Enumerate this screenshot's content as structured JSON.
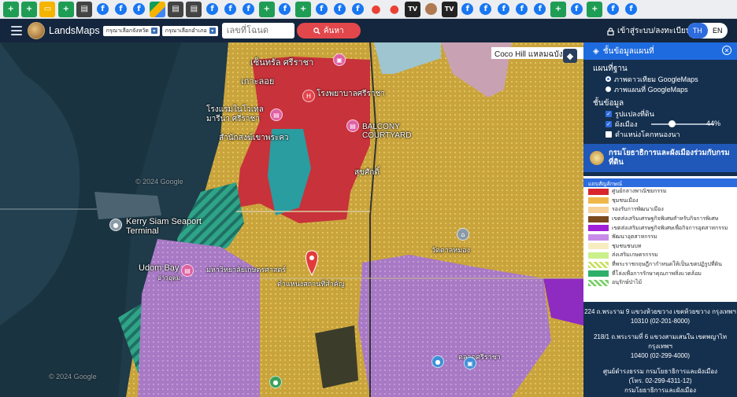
{
  "header": {
    "brand": "LandsMaps",
    "province_placeholder": "กรุณาเลือกจังหวัด",
    "district_placeholder": "กรุณาเลือกอำเภอ",
    "deed_placeholder": "เลขที่โฉนด",
    "search_label": "ค้นหา",
    "login_label": "เข้าสู่ระบบ/ลงทะเบียน",
    "lang_th": "TH",
    "lang_en": "EN"
  },
  "bookmarks": [
    "sheet",
    "sheet",
    "slide",
    "sheet",
    "doc",
    "fb",
    "fb",
    "fb",
    "drive",
    "doc",
    "doc",
    "fb",
    "fb",
    "fb",
    "sheet",
    "fb",
    "sheet",
    "fb",
    "fb",
    "fb",
    "pin",
    "pin",
    "tv",
    "photo",
    "tv",
    "fb",
    "fb",
    "fb",
    "fb",
    "fb",
    "sheet",
    "fb",
    "sheet",
    "fb",
    "fb"
  ],
  "map": {
    "tooltip": "Coco Hill แหลมฉบัง",
    "labels": {
      "central": "เซ็นทรัล ศรีราชา",
      "koh_loi": "เกาะลอย",
      "hospital": "โรงพยาบาลศรีราชา",
      "hotel": "โรงแรมในโวเทล มารีนา ศรีราชา",
      "office": "สำนักสงฆ์เขาพระคว",
      "balcony": "BALCONY COURTYARD",
      "kerry": "Kerry Siam Seaport Terminal",
      "udom_bay": "Udom Bay",
      "udom_bay_th": "อ่าวอุดม",
      "university": "มหาวิทยาลัยเกษตรศาสตร์",
      "landmark": "ตำแหน่งสถานที่สำคัญ",
      "sukhumvit": "สุขศักดิ์",
      "wat": "วัดตาลหมอง",
      "market": "ตลาดศรีราชา",
      "copyright1": "© 2024 Google",
      "copyright2": "© 2024 Google"
    }
  },
  "panel": {
    "title": "ชั้นข้อมูลแผนที่",
    "basemap_title": "แผนที่ฐาน",
    "basemap_options": [
      "ภาพดาวเทียม GoogleMaps",
      "ภาพแผนที่ GoogleMaps"
    ],
    "layers_title": "ชั้นข้อมูล",
    "layer_options": [
      "รูปแปลงที่ดิน",
      "ผังเมือง",
      "ตำแหน่งโคกหนองนา"
    ],
    "opacity": "44%",
    "org_name": "กรมโยธาธิการและผังเมืองร่วมกับกรมที่ดิน",
    "legend_title": "แถบสัญลักษณ์",
    "legend": [
      {
        "label": "ศูนย์กลางพาณิชยกรรม",
        "color": "#d9262c"
      },
      {
        "label": "ชุมชนเมือง",
        "color": "#f0b84a"
      },
      {
        "label": "รองรับการพัฒนาเมือง",
        "color": "#f7d19a"
      },
      {
        "label": "เขตส่งเสริมเศรษฐกิจพิเศษสำหรับกิจการพิเศษ",
        "color": "#7a4a1e"
      },
      {
        "label": "เขตส่งเสริมเศรษฐกิจพิเศษเพื่อกิจการอุตสาหกรรม",
        "color": "#a020d8"
      },
      {
        "label": "พัฒนาอุตสาหกรรม",
        "color": "#c88be8"
      },
      {
        "label": "ชุมชนชนบท",
        "color": "#f6ecc0"
      },
      {
        "label": "ส่งเสริมเกษตรกรรม",
        "color": "#c9f08a"
      },
      {
        "label": "ที่พระราชกฤษฎีกากำหนดให้เป็นเขตปฏิรูปที่ดิน",
        "color": "#c8e060"
      },
      {
        "label": "ที่โล่งเพื่อการรักษาคุณภาพสิ่งแวดล้อม",
        "color": "#2fb06a"
      },
      {
        "label": "อนุรักษ์ป่าไม้",
        "color": "#7ad06a"
      }
    ],
    "address1_line1": "224 ถ.พระราม 9 แขวงห้วยขวาง เขตห้วยขวาง กรุงเทพฯ",
    "address1_line2": "10310 (02-201-8000)",
    "address2_line1": "218/1 ถ.พระรามที่ 6 แขวงสามเสนใน เขตพญาไท กรุงเทพฯ",
    "address2_line2": "10400 (02-299-4000)",
    "address3_line1": "ศูนย์ดำรงธรรม กรมโยธาธิการและผังเมือง",
    "address3_line2": "(โทร. 02-299-4311-12)",
    "address3_line3": "กรมโยธาธิการและผังเมือง"
  }
}
